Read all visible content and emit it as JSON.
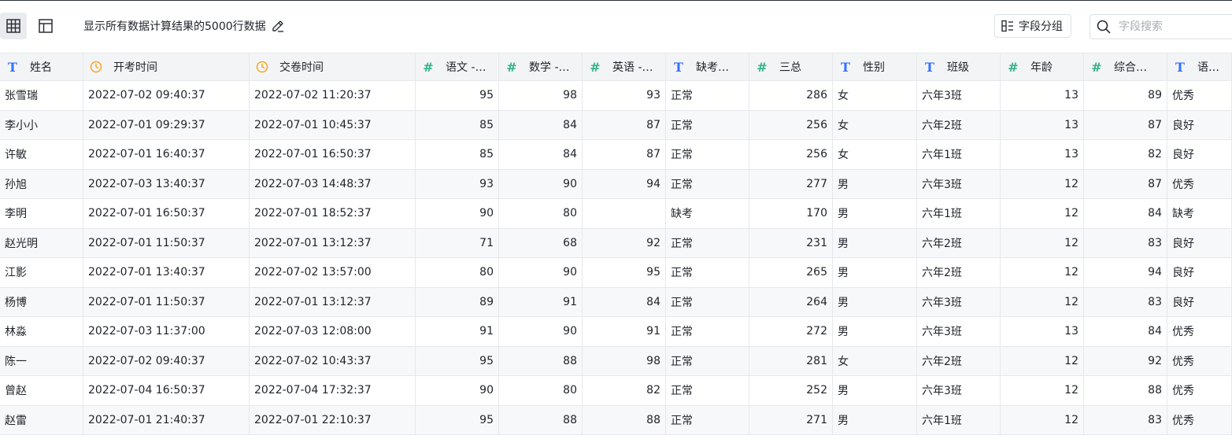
{
  "toolbar": {
    "title": "显示所有数据计算结果的5000行数据",
    "group_label": "字段分组",
    "search_placeholder": "字段搜索"
  },
  "columns": [
    {
      "label": "姓名",
      "type": "text",
      "icon": "text-type-icon"
    },
    {
      "label": "开考时间",
      "type": "time",
      "icon": "clock-icon"
    },
    {
      "label": "交卷时间",
      "type": "time",
      "icon": "clock-icon"
    },
    {
      "label": "语文 -…",
      "type": "number",
      "icon": "number-type-icon"
    },
    {
      "label": "数学 -…",
      "type": "number",
      "icon": "number-type-icon"
    },
    {
      "label": "英语 -…",
      "type": "number",
      "icon": "number-type-icon"
    },
    {
      "label": "缺考…",
      "type": "text",
      "icon": "text-type-icon"
    },
    {
      "label": "三总",
      "type": "number",
      "icon": "number-type-icon"
    },
    {
      "label": "性别",
      "type": "text",
      "icon": "text-type-icon"
    },
    {
      "label": "班级",
      "type": "text",
      "icon": "text-type-icon"
    },
    {
      "label": "年龄",
      "type": "number",
      "icon": "number-type-icon"
    },
    {
      "label": "综合…",
      "type": "number",
      "icon": "number-type-icon"
    },
    {
      "label": "语文…",
      "type": "text",
      "icon": "text-type-icon"
    }
  ],
  "rows": [
    [
      "张雪瑞",
      "2022-07-02 09:40:37",
      "2022-07-02 11:20:37",
      "95",
      "98",
      "93",
      "正常",
      "286",
      "女",
      "六年3班",
      "13",
      "89",
      "优秀"
    ],
    [
      "李小小",
      "2022-07-01 09:29:37",
      "2022-07-01 10:45:37",
      "85",
      "84",
      "87",
      "正常",
      "256",
      "女",
      "六年2班",
      "13",
      "87",
      "良好"
    ],
    [
      "许敏",
      "2022-07-01 16:40:37",
      "2022-07-01 16:50:37",
      "85",
      "84",
      "87",
      "正常",
      "256",
      "女",
      "六年1班",
      "13",
      "82",
      "良好"
    ],
    [
      "孙旭",
      "2022-07-03 13:40:37",
      "2022-07-03 14:48:37",
      "93",
      "90",
      "94",
      "正常",
      "277",
      "男",
      "六年3班",
      "12",
      "87",
      "优秀"
    ],
    [
      "李明",
      "2022-07-01 16:50:37",
      "2022-07-01 18:52:37",
      "90",
      "80",
      "",
      "缺考",
      "170",
      "男",
      "六年1班",
      "12",
      "84",
      "缺考"
    ],
    [
      "赵光明",
      "2022-07-01 11:50:37",
      "2022-07-01 13:12:37",
      "71",
      "68",
      "92",
      "正常",
      "231",
      "男",
      "六年2班",
      "12",
      "83",
      "良好"
    ],
    [
      "江影",
      "2022-07-01 13:40:37",
      "2022-07-02 13:57:00",
      "80",
      "90",
      "95",
      "正常",
      "265",
      "男",
      "六年2班",
      "12",
      "94",
      "良好"
    ],
    [
      "杨博",
      "2022-07-01 11:50:37",
      "2022-07-01 13:12:37",
      "89",
      "91",
      "84",
      "正常",
      "264",
      "男",
      "六年3班",
      "12",
      "83",
      "良好"
    ],
    [
      "林淼",
      "2022-07-03 11:37:00",
      "2022-07-03 12:08:00",
      "91",
      "90",
      "91",
      "正常",
      "272",
      "男",
      "六年3班",
      "13",
      "84",
      "优秀"
    ],
    [
      "陈一",
      "2022-07-02 09:40:37",
      "2022-07-02 10:43:37",
      "95",
      "88",
      "98",
      "正常",
      "281",
      "女",
      "六年2班",
      "12",
      "92",
      "优秀"
    ],
    [
      "曾赵",
      "2022-07-04 16:50:37",
      "2022-07-04 17:32:37",
      "90",
      "80",
      "82",
      "正常",
      "252",
      "男",
      "六年3班",
      "12",
      "88",
      "优秀"
    ],
    [
      "赵雷",
      "2022-07-01 21:40:37",
      "2022-07-01 22:10:37",
      "95",
      "88",
      "88",
      "正常",
      "271",
      "男",
      "六年1班",
      "12",
      "83",
      "优秀"
    ]
  ],
  "colors": {
    "text_icon": "#3370ff",
    "number_icon": "#33b28a",
    "time_icon": "#f5a623",
    "header_bg": "#f3f4f6",
    "alt_row_bg": "#f7f8fa"
  }
}
